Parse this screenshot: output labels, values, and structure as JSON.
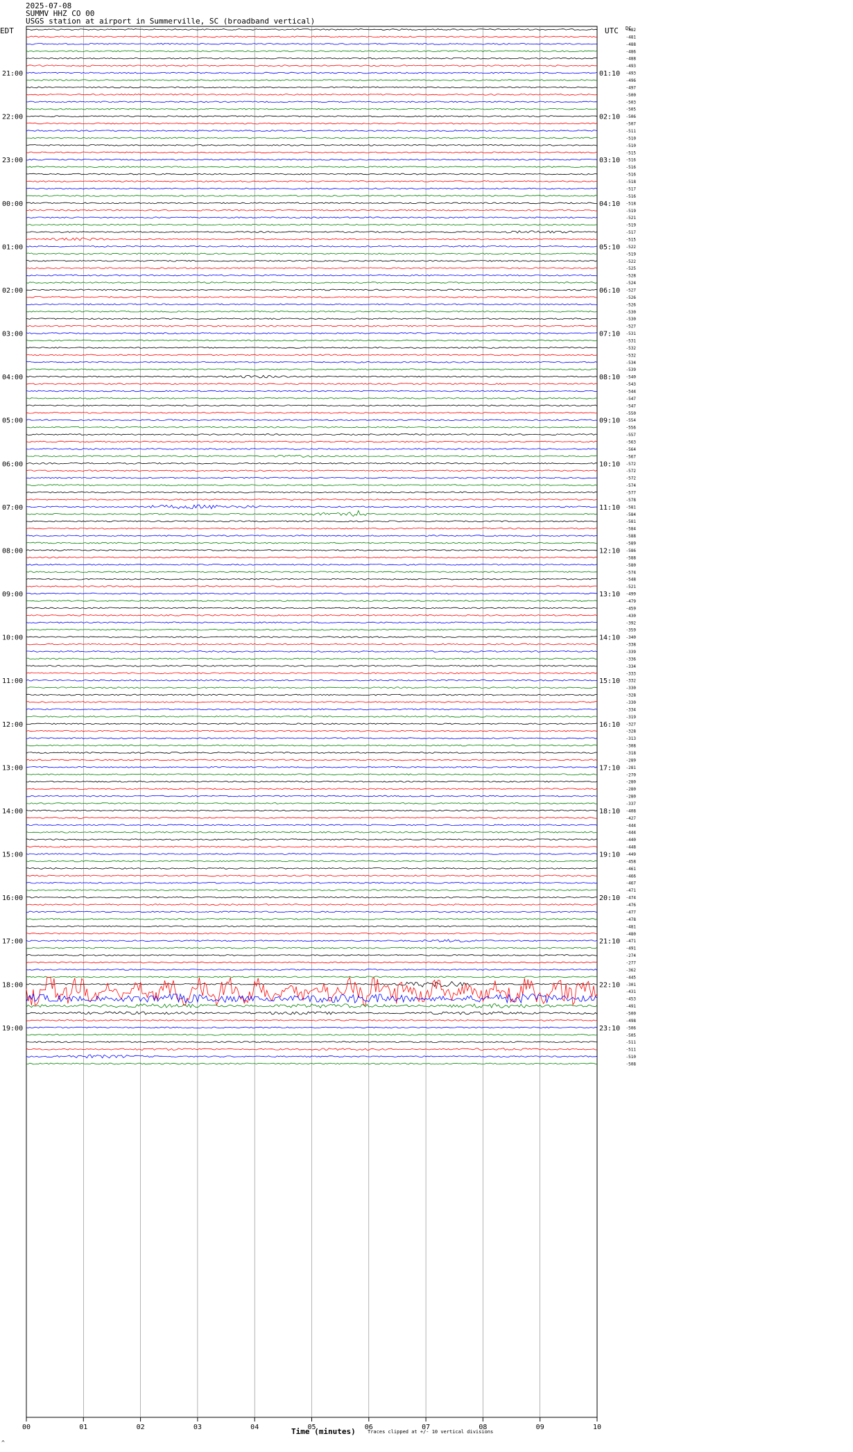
{
  "header": {
    "date": "2025-07-08",
    "station": "SUMMV HHZ CO 00",
    "description": "USGS station at airport in Summerville, SC (broadband vertical)"
  },
  "left_axis_title": "EDT",
  "right_axis_title": "UTC",
  "right_axis_sub": "DC",
  "footer": {
    "xlabel": "Time (minutes)",
    "note": "Traces clipped at +/- 10 vertical divisions",
    "corner": "^"
  },
  "colors": {
    "cycle": [
      "#000000",
      "#ff0000",
      "#0000ff",
      "#008000"
    ],
    "grid": "#808080"
  },
  "chart_data": {
    "type": "line",
    "title": "",
    "xlabel": "Time (minutes)",
    "xlim": [
      0,
      10
    ],
    "x_ticks": [
      "00",
      "01",
      "02",
      "03",
      "04",
      "05",
      "06",
      "07",
      "08",
      "09",
      "10"
    ],
    "row_count": 144,
    "edt_labels": [
      "21:00",
      "22:00",
      "23:00",
      "00:00",
      "01:00",
      "02:00",
      "03:00",
      "04:00",
      "05:00",
      "06:00",
      "07:00",
      "08:00",
      "09:00",
      "10:00",
      "11:00",
      "12:00",
      "13:00",
      "14:00",
      "15:00",
      "16:00",
      "17:00",
      "18:00",
      "19:00"
    ],
    "utc_labels": [
      "01:10",
      "02:10",
      "03:10",
      "04:10",
      "05:10",
      "06:10",
      "07:10",
      "08:10",
      "09:10",
      "10:10",
      "11:10",
      "12:10",
      "13:10",
      "14:10",
      "15:10",
      "16:10",
      "17:10",
      "18:10",
      "19:10",
      "20:10",
      "21:10",
      "22:10",
      "23:10"
    ],
    "dc_offsets": [
      -482,
      -481,
      -488,
      -486,
      -488,
      -493,
      -493,
      -496,
      -497,
      -500,
      -503,
      -505,
      -506,
      -507,
      -511,
      -510,
      -510,
      -515,
      -516,
      -516,
      -516,
      -518,
      -517,
      -516,
      -518,
      -519,
      -521,
      -519,
      -517,
      -515,
      -522,
      -519,
      -522,
      -525,
      -528,
      -524,
      -527,
      -526,
      -526,
      -530,
      -530,
      -527,
      -531,
      -531,
      -532,
      -532,
      -534,
      -539,
      -540,
      -543,
      -544,
      -547,
      -547,
      -550,
      -554,
      -556,
      -557,
      -563,
      -564,
      -567,
      -572,
      -572,
      -572,
      -574,
      -577,
      -578,
      -581,
      -584,
      -581,
      -584,
      -588,
      -589,
      -586,
      -588,
      -580,
      -574,
      -548,
      -521,
      -499,
      -479,
      -459,
      -430,
      -392,
      -359,
      -340,
      -338,
      -339,
      -336,
      -334,
      -333,
      -332,
      -330,
      -328,
      -330,
      -334,
      -319,
      -327,
      -328,
      -313,
      -308,
      -318,
      -289,
      -281,
      -270,
      -280,
      -280,
      -280,
      -337,
      -408,
      -427,
      -444,
      -444,
      -440,
      -448,
      -449,
      -458,
      -461,
      -466,
      -467,
      -471,
      -474,
      -476,
      -477,
      -478,
      -481,
      -480,
      -471,
      -491,
      -274,
      -277,
      -362,
      -445,
      -301,
      -431,
      -453,
      -491,
      -500,
      -498,
      -506,
      -505,
      -511,
      -511,
      -510,
      -508,
      -510,
      -516
    ],
    "events": [
      {
        "row": 28,
        "from": 7.9,
        "to": 10,
        "amplitude": 2.0
      },
      {
        "row": 29,
        "from": 0,
        "to": 1.8,
        "amplitude": 2.2
      },
      {
        "row": 48,
        "from": 3.0,
        "to": 5.2,
        "amplitude": 2.0
      },
      {
        "row": 59,
        "from": 3.9,
        "to": 5.5,
        "amplitude": 1.6
      },
      {
        "row": 66,
        "from": 1.4,
        "to": 4.6,
        "amplitude": 3.0
      },
      {
        "row": 67,
        "from": 4.4,
        "to": 6.2,
        "amplitude": 3.5,
        "peak": 5.8
      },
      {
        "row": 126,
        "from": 6.5,
        "to": 8.5,
        "amplitude": 2.0
      },
      {
        "row": 132,
        "from": 6.3,
        "to": 8.0,
        "amplitude": 4.5
      },
      {
        "row": 133,
        "from": 0,
        "to": 10,
        "amplitude": 16
      },
      {
        "row": 134,
        "from": 0,
        "to": 10,
        "amplitude": 7
      },
      {
        "row": 135,
        "from": 0,
        "to": 10,
        "amplitude": 3
      },
      {
        "row": 136,
        "from": 0,
        "to": 10,
        "amplitude": 2.2
      },
      {
        "row": 141,
        "from": 0,
        "to": 10,
        "amplitude": 1.6
      },
      {
        "row": 142,
        "from": 0,
        "to": 2.5,
        "amplitude": 2.5
      }
    ]
  }
}
